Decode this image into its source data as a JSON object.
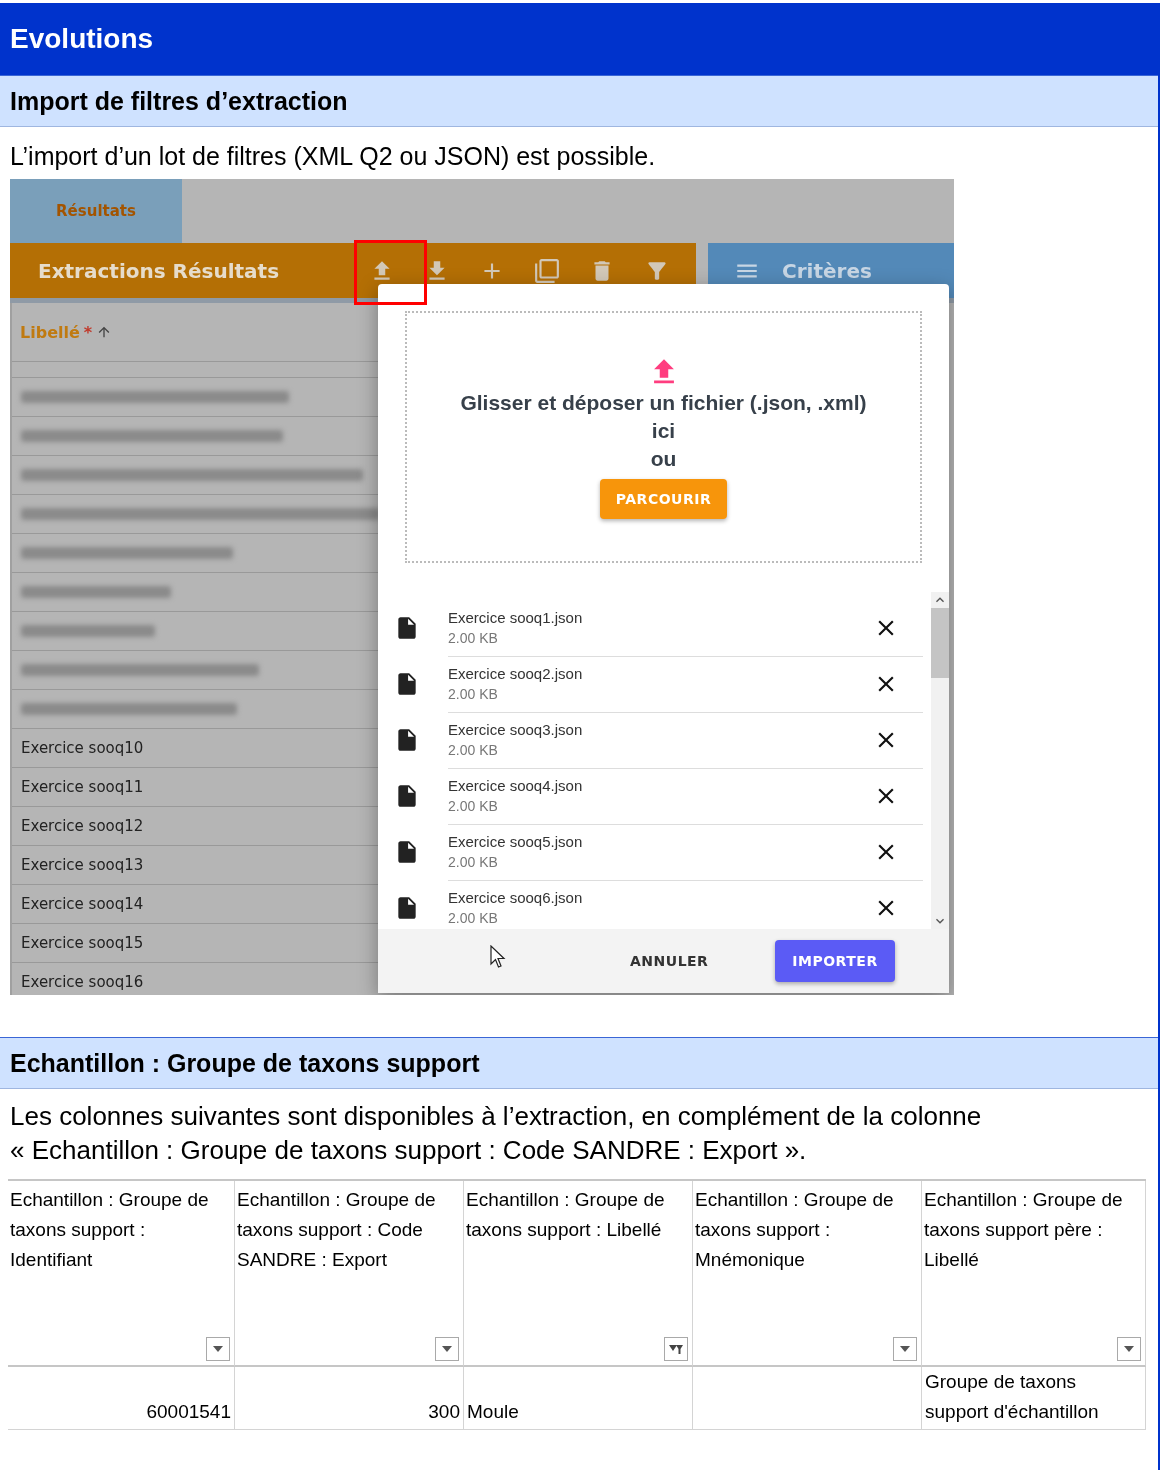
{
  "title": "Evolutions",
  "import_section": {
    "heading": "Import de filtres d’extraction",
    "text": "L’import d’un lot de filtres (XML Q2 ou JSON) est possible.",
    "screenshot": {
      "tabs": [
        {
          "label": "Résultats",
          "selected": true
        }
      ],
      "toolbar": {
        "title": "Extractions Résultats",
        "upload_highlighted": true
      },
      "criteria_panel": {
        "title": "Critères"
      },
      "list": {
        "column": "Libellé",
        "required_mark": "*",
        "rows": [
          "Exercice sooq10",
          "Exercice sooq11",
          "Exercice sooq12",
          "Exercice sooq13",
          "Exercice sooq14",
          "Exercice sooq15",
          "Exercice sooq16"
        ]
      },
      "dialog": {
        "drop_lines": [
          "Glisser et déposer un fichier (.json, .xml)",
          "ici",
          "ou"
        ],
        "browse_button": "PARCOURIR",
        "files": [
          {
            "name": "Exercice sooq1.json",
            "size": "2.00 KB"
          },
          {
            "name": "Exercice sooq2.json",
            "size": "2.00 KB"
          },
          {
            "name": "Exercice sooq3.json",
            "size": "2.00 KB"
          },
          {
            "name": "Exercice sooq4.json",
            "size": "2.00 KB"
          },
          {
            "name": "Exercice sooq5.json",
            "size": "2.00 KB"
          },
          {
            "name": "Exercice sooq6.json",
            "size": "2.00 KB"
          }
        ],
        "cancel_button": "ANNULER",
        "import_button": "IMPORTER"
      }
    }
  },
  "sample_section": {
    "heading": "Echantillon : Groupe de taxons support",
    "text": "Les colonnes suivantes sont disponibles à l’extraction, en complément de la colonne « Echantillon : Groupe de taxons support : Code SANDRE : Export ».",
    "table": {
      "columns": [
        {
          "label": "Echantillon : Groupe de taxons support : Identifiant",
          "filtered": false
        },
        {
          "label": "Echantillon : Groupe de taxons support : Code SANDRE : Export",
          "filtered": false
        },
        {
          "label": "Echantillon : Groupe de taxons support : Libellé",
          "filtered": true
        },
        {
          "label": "Echantillon : Groupe de taxons support : Mnémonique",
          "filtered": false
        },
        {
          "label": "Echantillon : Groupe de taxons support père : Libellé",
          "filtered": false
        }
      ],
      "rows": [
        {
          "cells": [
            {
              "text": "60001541",
              "kind": "number"
            },
            {
              "text": "300",
              "kind": "number"
            },
            {
              "text": "Moule",
              "kind": "text"
            },
            null,
            {
              "text": "Groupe de taxons support d'échantillon",
              "kind": "text"
            }
          ]
        }
      ]
    }
  }
}
